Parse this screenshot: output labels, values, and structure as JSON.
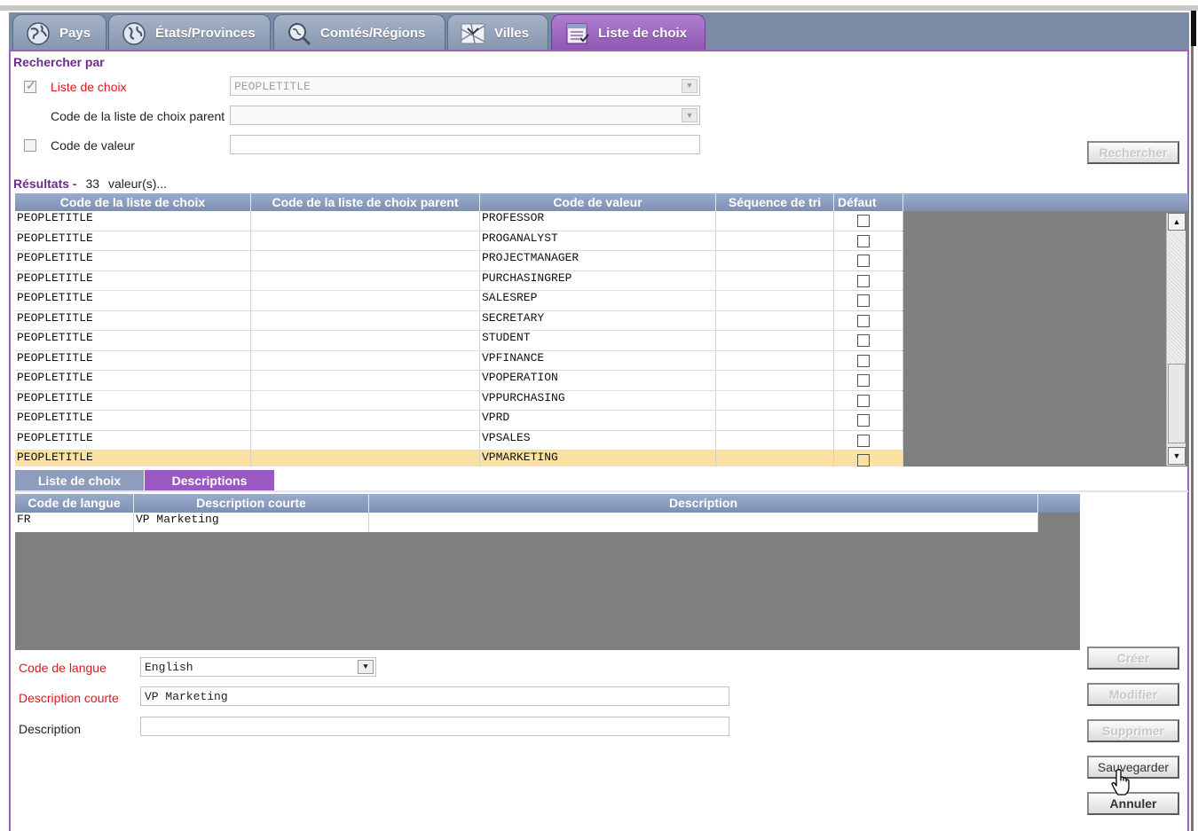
{
  "tabs": [
    {
      "label": "Pays",
      "icon": "globe-icon",
      "active": false
    },
    {
      "label": "États/Provinces",
      "icon": "globe-region-icon",
      "active": false
    },
    {
      "label": "Comtés/Régions",
      "icon": "magnifier-map-icon",
      "active": false
    },
    {
      "label": "Villes",
      "icon": "city-map-icon",
      "active": false
    },
    {
      "label": "Liste de choix",
      "icon": "list-icon",
      "active": true
    }
  ],
  "search": {
    "title": "Rechercher par",
    "picklist_label": "Liste de choix",
    "picklist_value": "PEOPLETITLE",
    "parent_label": "Code de la liste de choix parent",
    "parent_value": "",
    "value_code_label": "Code de valeur",
    "value_code_value": "",
    "search_button": "Rechercher"
  },
  "results": {
    "title": "Résultats -",
    "count": "33",
    "suffix": "valeur(s)...",
    "columns": [
      "Code de la liste de choix",
      "Code de la liste de choix parent",
      "Code de valeur",
      "Séquence de tri",
      "Défaut"
    ],
    "rows": [
      {
        "picklist": "PEOPLETITLE",
        "parent": "",
        "value": "PROFESSOR",
        "seq": "",
        "default": false
      },
      {
        "picklist": "PEOPLETITLE",
        "parent": "",
        "value": "PROGANALYST",
        "seq": "",
        "default": false
      },
      {
        "picklist": "PEOPLETITLE",
        "parent": "",
        "value": "PROJECTMANAGER",
        "seq": "",
        "default": false
      },
      {
        "picklist": "PEOPLETITLE",
        "parent": "",
        "value": "PURCHASINGREP",
        "seq": "",
        "default": false
      },
      {
        "picklist": "PEOPLETITLE",
        "parent": "",
        "value": "SALESREP",
        "seq": "",
        "default": false
      },
      {
        "picklist": "PEOPLETITLE",
        "parent": "",
        "value": "SECRETARY",
        "seq": "",
        "default": false
      },
      {
        "picklist": "PEOPLETITLE",
        "parent": "",
        "value": "STUDENT",
        "seq": "",
        "default": false
      },
      {
        "picklist": "PEOPLETITLE",
        "parent": "",
        "value": "VPFINANCE",
        "seq": "",
        "default": false
      },
      {
        "picklist": "PEOPLETITLE",
        "parent": "",
        "value": "VPOPERATION",
        "seq": "",
        "default": false
      },
      {
        "picklist": "PEOPLETITLE",
        "parent": "",
        "value": "VPPURCHASING",
        "seq": "",
        "default": false
      },
      {
        "picklist": "PEOPLETITLE",
        "parent": "",
        "value": "VPRD",
        "seq": "",
        "default": false
      },
      {
        "picklist": "PEOPLETITLE",
        "parent": "",
        "value": "VPSALES",
        "seq": "",
        "default": false
      },
      {
        "picklist": "PEOPLETITLE",
        "parent": "",
        "value": "VPMARKETING",
        "seq": "",
        "default": false,
        "selected": true
      }
    ]
  },
  "subtabs": {
    "picklist": "Liste de choix",
    "descriptions": "Descriptions"
  },
  "descriptions": {
    "columns": [
      "Code de langue",
      "Description courte",
      "Description"
    ],
    "rows": [
      {
        "lang": "FR",
        "short": "VP Marketing",
        "desc": ""
      }
    ]
  },
  "form": {
    "lang_label": "Code de langue",
    "lang_value": "English",
    "short_label": "Description courte",
    "short_value": "VP Marketing",
    "desc_label": "Description",
    "desc_value": ""
  },
  "buttons": {
    "create": "Créer",
    "modify": "Modifier",
    "delete": "Supprimer",
    "save": "Sauvegarder",
    "cancel": "Annuler"
  },
  "colors": {
    "accent_purple": "#9b63bf",
    "required_red": "#e0161d",
    "header_blue": "#8597b8",
    "selected_row": "#fbe2a3"
  }
}
